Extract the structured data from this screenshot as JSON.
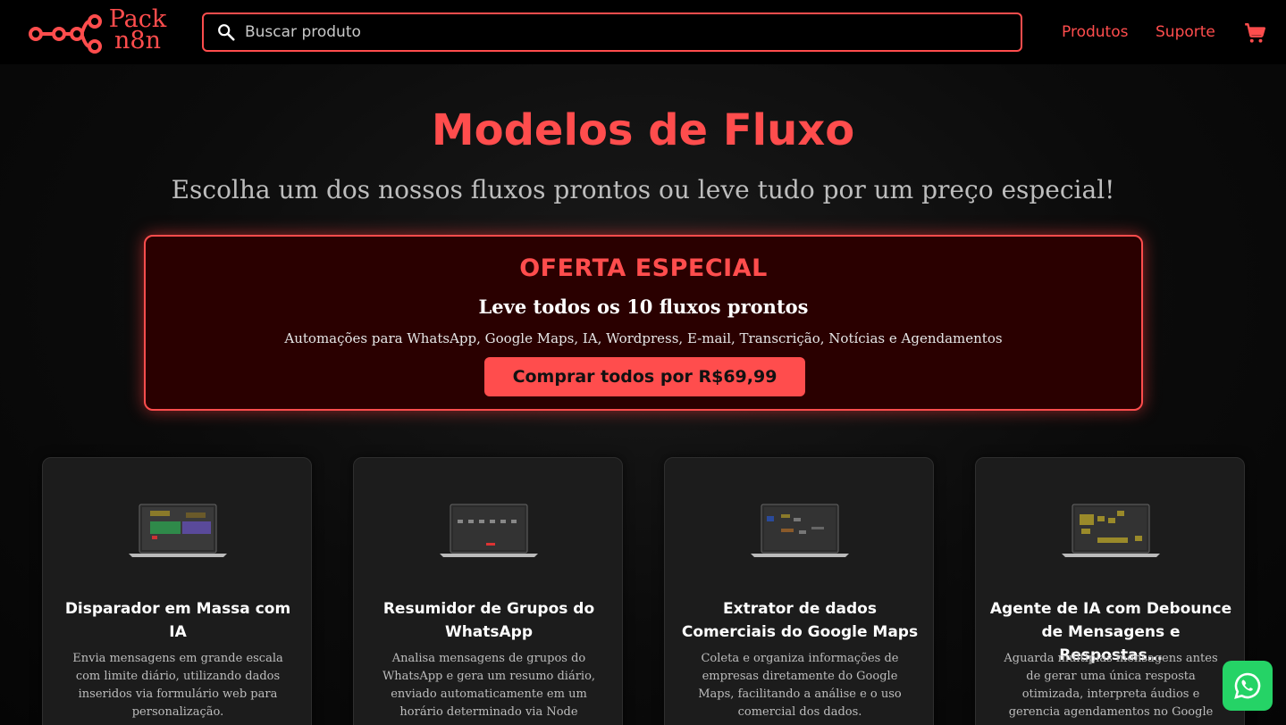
{
  "brand": {
    "line1": "Pack",
    "line2": "n8n",
    "color": "#ff4d4d"
  },
  "search": {
    "placeholder": "Buscar produto",
    "value": ""
  },
  "nav": {
    "produtos": "Produtos",
    "suporte": "Suporte"
  },
  "hero": {
    "title": "Modelos de Fluxo",
    "subtitle": "Escolha um dos nossos fluxos prontos ou leve tudo por um preço especial!"
  },
  "offer": {
    "title": "OFERTA ESPECIAL",
    "headline": "Leve todos os 10 fluxos prontos",
    "description": "Automações para WhatsApp, Google Maps, IA, Wordpress, E-mail, Transcrição, Notícias e Agendamentos",
    "button": "Comprar todos por R$69,99"
  },
  "cards": [
    {
      "title": "Disparador em Massa com\nIA",
      "description": "Envia mensagens em grande escala\ncom limite diário, utilizando dados\ninseridos via formulário web para\npersonalização."
    },
    {
      "title": "Resumidor de Grupos do\nWhatsApp",
      "description": "Analisa mensagens de grupos do\nWhatsApp e gera um resumo diário,\nenviado automaticamente em um\nhorário determinado via Node"
    },
    {
      "title": "Extrator de dados\nComerciais do Google Maps",
      "description": "Coleta e organiza informações de\nempresas diretamente do Google\nMaps, facilitando a análise e o uso\ncomercial dos dados."
    },
    {
      "title": "Agente de IA com Debounce\nde Mensagens e Respostas…",
      "description": "Aguarda múltiplas mensagens antes\nde gerar uma única resposta\notimizada, interpreta áudios e\ngerencia agendamentos no Google"
    }
  ],
  "colors": {
    "accent": "#ff4d4d",
    "whatsapp": "#25d366",
    "offer_bg": "#2a0000"
  },
  "icons": [
    "n8n-logo-icon",
    "search-icon",
    "cart-icon",
    "whatsapp-icon"
  ]
}
